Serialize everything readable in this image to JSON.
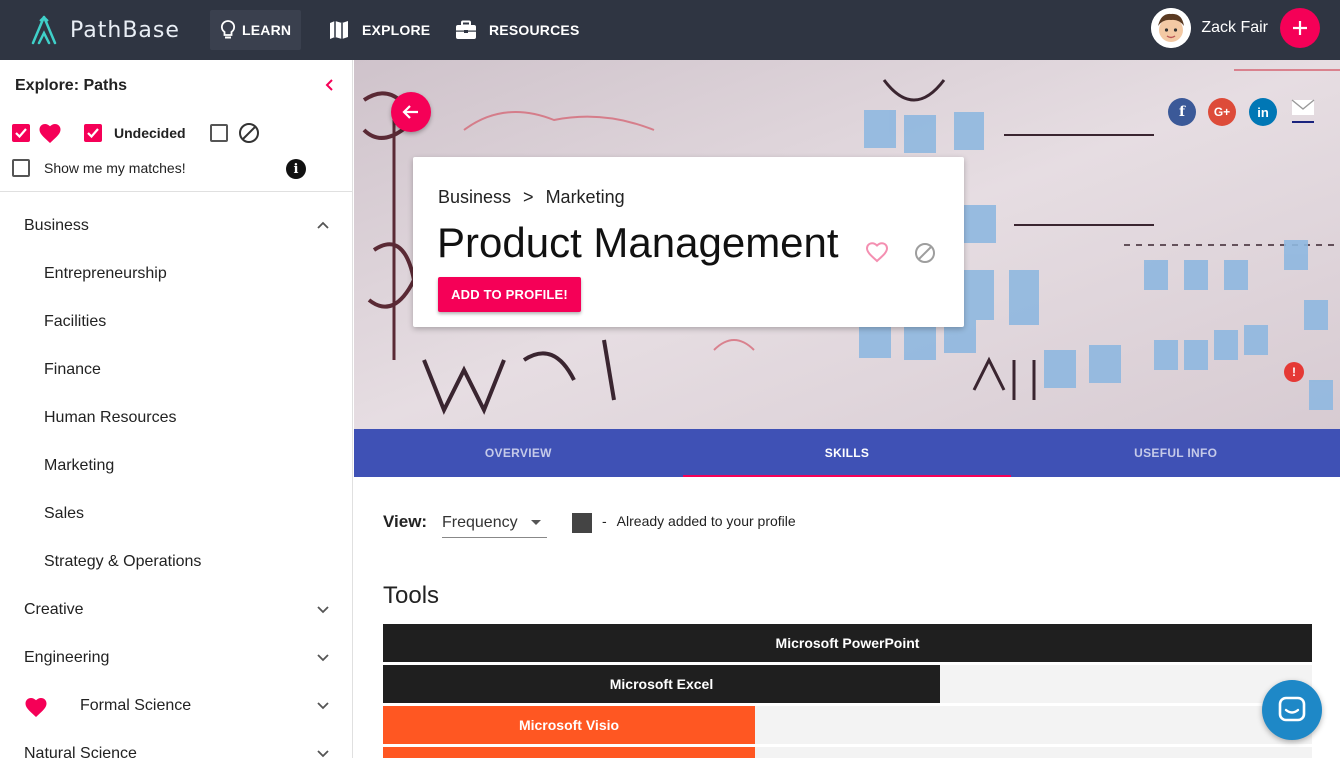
{
  "app": {
    "brand": "PathBase"
  },
  "nav": {
    "items": [
      {
        "label": "LEARN",
        "icon": "lightbulb-icon",
        "active": true
      },
      {
        "label": "EXPLORE",
        "icon": "map-icon",
        "active": false
      },
      {
        "label": "RESOURCES",
        "icon": "briefcase-icon",
        "active": false
      }
    ]
  },
  "user": {
    "name": "Zack Fair"
  },
  "sidebar": {
    "title": "Explore: Paths",
    "filters": {
      "undecided_label": "Undecided",
      "matches_label": "Show me my matches!"
    },
    "categories": [
      {
        "label": "Business",
        "expanded": true
      },
      {
        "label": "Creative",
        "expanded": false
      },
      {
        "label": "Engineering",
        "expanded": false
      },
      {
        "label": "Formal Science",
        "expanded": false,
        "favorited": true
      },
      {
        "label": "Natural Science",
        "expanded": false
      }
    ],
    "business_subs": [
      "Entrepreneurship",
      "Facilities",
      "Finance",
      "Human Resources",
      "Marketing",
      "Sales",
      "Strategy & Operations"
    ]
  },
  "card": {
    "crumb_parent": "Business",
    "crumb_sep": ">",
    "crumb_child": "Marketing",
    "title": "Product Management",
    "add_label": "ADD TO PROFILE!"
  },
  "social": {
    "facebook": "f",
    "google": "G+",
    "linkedin": "in"
  },
  "tabs": [
    {
      "label": "OVERVIEW",
      "active": false
    },
    {
      "label": "SKILLS",
      "active": true
    },
    {
      "label": "USEFUL INFO",
      "active": false
    }
  ],
  "skills": {
    "view_label": "View:",
    "view_value": "Frequency",
    "legend_dash": "-",
    "legend_text": "Already added to your profile",
    "section_title": "Tools",
    "tools": [
      {
        "name": "Microsoft PowerPoint",
        "fraction": 1.0,
        "color": "#1f1f1f"
      },
      {
        "name": "Microsoft Excel",
        "fraction": 0.6,
        "color": "#1f1f1f"
      },
      {
        "name": "Microsoft Visio",
        "fraction": 0.4,
        "color": "#ff5722"
      },
      {
        "name": "",
        "fraction": 0.4,
        "color": "#ff5722"
      }
    ]
  },
  "colors": {
    "accent": "#f50057",
    "tabs": "#3f51b5",
    "topbar": "#2f3542",
    "added": "#444444",
    "not_added": "#ff5722"
  }
}
